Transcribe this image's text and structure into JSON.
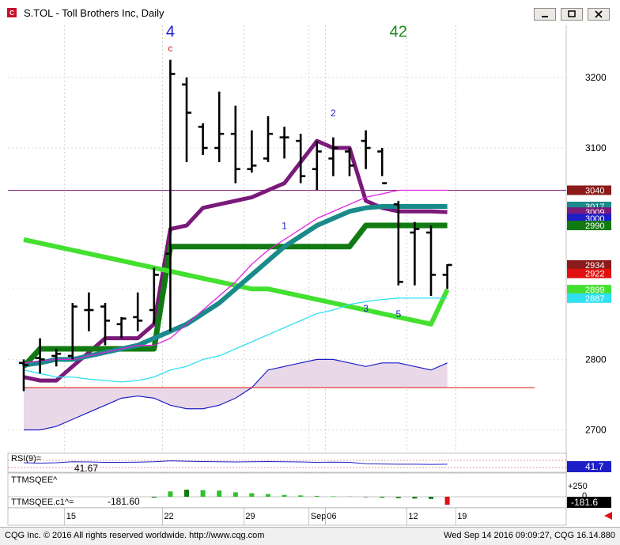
{
  "window": {
    "title": "S.TOL - Toll Brothers Inc, Daily"
  },
  "status": {
    "copyright": "CQG Inc. © 2016 All rights reserved worldwide. http://www.cqg.com",
    "timestamp": "Wed Sep 14 2016 09:09:27, CQG 16.14.880"
  },
  "chart_data": {
    "type": "bar",
    "instrument": "S.TOL",
    "name": "Toll Brothers Inc",
    "interval": "Daily",
    "price_axis": {
      "ticks": [
        3200,
        3100,
        2900,
        2800,
        2700
      ],
      "range": [
        2668,
        3265
      ]
    },
    "date_axis": {
      "labels": [
        "15",
        "22",
        "29",
        "Sep",
        "06",
        "12",
        "19"
      ]
    },
    "annotations": [
      {
        "text": "4",
        "color": "#1e1ec8",
        "x_bar": 9,
        "price": 3258
      },
      {
        "text": "c",
        "color": "#e01010",
        "x_bar": 9,
        "price": 3237
      },
      {
        "text": "42",
        "color": "#1a8a1a",
        "x_bar": 23,
        "price": 3258
      },
      {
        "text": "1",
        "color": "#1e1ec8",
        "x_bar": 16,
        "price": 2985
      },
      {
        "text": "2",
        "color": "#1e1ec8",
        "x_bar": 19,
        "price": 3145
      },
      {
        "text": "3",
        "color": "#1e1ec8",
        "x_bar": 21,
        "price": 2868
      },
      {
        "text": "5",
        "color": "#1e1ec8",
        "x_bar": 23,
        "price": 2860
      }
    ],
    "ohlc": [
      {
        "o": 2795,
        "h": 2800,
        "l": 2755,
        "c": 2792
      },
      {
        "o": 2802,
        "h": 2830,
        "l": 2780,
        "c": 2800
      },
      {
        "o": 2805,
        "h": 2815,
        "l": 2790,
        "c": 2808
      },
      {
        "o": 2805,
        "h": 2880,
        "l": 2800,
        "c": 2875
      },
      {
        "o": 2870,
        "h": 2895,
        "l": 2840,
        "c": 2870
      },
      {
        "o": 2875,
        "h": 2880,
        "l": 2820,
        "c": 2855
      },
      {
        "o": 2850,
        "h": 2860,
        "l": 2830,
        "c": 2858
      },
      {
        "o": 2860,
        "h": 2895,
        "l": 2840,
        "c": 2855
      },
      {
        "o": 2870,
        "h": 2930,
        "l": 2850,
        "c": 2920
      },
      {
        "o": 2950,
        "h": 3225,
        "l": 2840,
        "c": 3205
      },
      {
        "o": 3190,
        "h": 3200,
        "l": 3080,
        "c": 3150
      },
      {
        "o": 3130,
        "h": 3135,
        "l": 3090,
        "c": 3100
      },
      {
        "o": 3100,
        "h": 3180,
        "l": 3080,
        "c": 3120
      },
      {
        "o": 3120,
        "h": 3160,
        "l": 3050,
        "c": 3070
      },
      {
        "o": 3070,
        "h": 3125,
        "l": 3065,
        "c": 3075
      },
      {
        "o": 3085,
        "h": 3145,
        "l": 3080,
        "c": 3120
      },
      {
        "o": 3115,
        "h": 3130,
        "l": 3085,
        "c": 3115
      },
      {
        "o": 3110,
        "h": 3120,
        "l": 3050,
        "c": 3060
      },
      {
        "o": 3070,
        "h": 3110,
        "l": 3040,
        "c": 3095
      },
      {
        "o": 3085,
        "h": 3115,
        "l": 3060,
        "c": 3100
      },
      {
        "o": 3095,
        "h": 3100,
        "l": 3060,
        "c": 3075
      },
      {
        "o": 3110,
        "h": 3125,
        "l": 3070,
        "c": 3100
      },
      {
        "o": 3095,
        "h": 3100,
        "l": 3060,
        "c": 3050
      },
      {
        "o": 3020,
        "h": 3025,
        "l": 2905,
        "c": 2910
      },
      {
        "o": 2980,
        "h": 2995,
        "l": 2905,
        "c": 2985
      },
      {
        "o": 2980,
        "h": 2990,
        "l": 2890,
        "c": 2920
      },
      {
        "o": 2920,
        "h": 2935,
        "l": 2900,
        "c": 2934
      }
    ],
    "series": [
      {
        "name": "purple-ma",
        "color": "#7a1a7a",
        "values": [
          2775,
          2770,
          2770,
          2790,
          2810,
          2830,
          2830,
          2830,
          2850,
          2985,
          2990,
          3015,
          3020,
          3025,
          3030,
          3040,
          3050,
          3080,
          3110,
          3100,
          3100,
          3025,
          3015,
          3010,
          3010,
          3010,
          3009
        ]
      },
      {
        "name": "dark-green-step",
        "color": "#127a12",
        "values": [
          2790,
          2815,
          2815,
          2815,
          2815,
          2815,
          2815,
          2815,
          2815,
          2960,
          2960,
          2960,
          2960,
          2960,
          2960,
          2960,
          2960,
          2960,
          2960,
          2960,
          2960,
          2990,
          2990,
          2990,
          2990,
          2990,
          2990
        ]
      },
      {
        "name": "bright-green-ma",
        "color": "#44e030",
        "values": [
          2970,
          2965,
          2960,
          2955,
          2950,
          2945,
          2940,
          2935,
          2930,
          2925,
          2920,
          2915,
          2910,
          2905,
          2900,
          2900,
          2895,
          2890,
          2885,
          2880,
          2875,
          2870,
          2865,
          2860,
          2855,
          2850,
          2899
        ]
      },
      {
        "name": "teal-ma",
        "color": "#1a8a8a",
        "values": [
          2792,
          2795,
          2800,
          2800,
          2805,
          2810,
          2815,
          2820,
          2830,
          2840,
          2850,
          2865,
          2880,
          2900,
          2920,
          2940,
          2960,
          2975,
          2990,
          3000,
          3010,
          3015,
          3017,
          3017,
          3017,
          3017,
          3017
        ]
      },
      {
        "name": "magenta-ma",
        "color": "#e020e0",
        "values": [
          2795,
          2798,
          2800,
          2800,
          2805,
          2810,
          2815,
          2820,
          2820,
          2830,
          2850,
          2870,
          2890,
          2910,
          2935,
          2955,
          2970,
          2985,
          3000,
          3010,
          3020,
          3030,
          3035,
          3040,
          3040,
          3040,
          3040
        ]
      },
      {
        "name": "cyan-ma",
        "color": "#30e0f0",
        "values": [
          2785,
          2780,
          2775,
          2775,
          2772,
          2770,
          2768,
          2770,
          2775,
          2785,
          2790,
          2800,
          2805,
          2815,
          2825,
          2835,
          2845,
          2855,
          2865,
          2870,
          2878,
          2882,
          2885,
          2887,
          2887,
          2887,
          2887
        ]
      }
    ],
    "price_labels": [
      {
        "value": "3040",
        "color": "#8b1a1a"
      },
      {
        "value": "3017",
        "color": "#1a8a8a"
      },
      {
        "value": "3009",
        "color": "#7a1a7a"
      },
      {
        "value": "3000",
        "color": "#1e1ec8"
      },
      {
        "value": "2990",
        "color": "#127a12"
      },
      {
        "value": "2934",
        "color": "#8b1a1a"
      },
      {
        "value": "2922",
        "color": "#e01010"
      },
      {
        "value": "2899",
        "color": "#44e030"
      },
      {
        "value": "2887",
        "color": "#30e0f0"
      }
    ],
    "rsi": {
      "label": "RSI(9)=",
      "value": "41.67",
      "axis_label": "41.7"
    },
    "ttm": {
      "label_top": "TTMSQEE^",
      "label_bottom": "TTMSQEE.c1^=",
      "value": "-181.60",
      "axis_top": "+250",
      "axis_zero": "0",
      "axis_value": "-181.6",
      "histogram": [
        0,
        0,
        0,
        0,
        0,
        0,
        0,
        0,
        -20,
        120,
        160,
        150,
        140,
        100,
        80,
        60,
        40,
        30,
        20,
        10,
        5,
        -10,
        -20,
        -30,
        -40,
        -50,
        -181.6
      ]
    }
  }
}
